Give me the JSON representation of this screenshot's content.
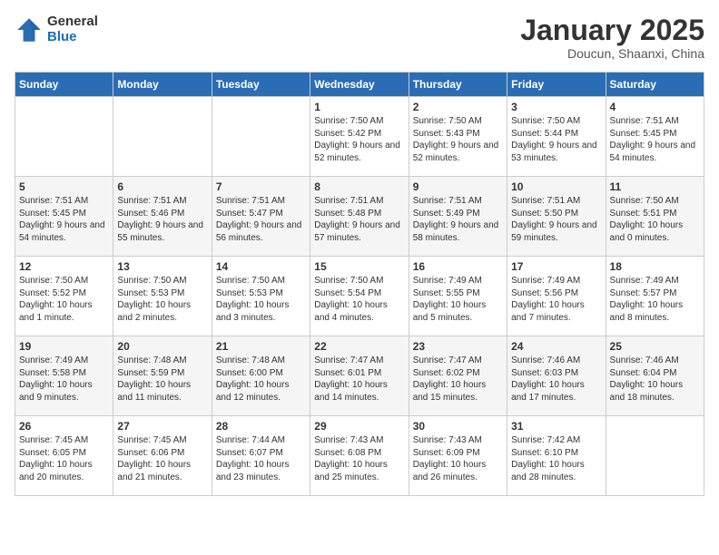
{
  "header": {
    "logo_general": "General",
    "logo_blue": "Blue",
    "month_title": "January 2025",
    "subtitle": "Doucun, Shaanxi, China"
  },
  "weekdays": [
    "Sunday",
    "Monday",
    "Tuesday",
    "Wednesday",
    "Thursday",
    "Friday",
    "Saturday"
  ],
  "weeks": [
    [
      {
        "day": "",
        "info": ""
      },
      {
        "day": "",
        "info": ""
      },
      {
        "day": "",
        "info": ""
      },
      {
        "day": "1",
        "info": "Sunrise: 7:50 AM\nSunset: 5:42 PM\nDaylight: 9 hours\nand 52 minutes."
      },
      {
        "day": "2",
        "info": "Sunrise: 7:50 AM\nSunset: 5:43 PM\nDaylight: 9 hours\nand 52 minutes."
      },
      {
        "day": "3",
        "info": "Sunrise: 7:50 AM\nSunset: 5:44 PM\nDaylight: 9 hours\nand 53 minutes."
      },
      {
        "day": "4",
        "info": "Sunrise: 7:51 AM\nSunset: 5:45 PM\nDaylight: 9 hours\nand 54 minutes."
      }
    ],
    [
      {
        "day": "5",
        "info": "Sunrise: 7:51 AM\nSunset: 5:45 PM\nDaylight: 9 hours\nand 54 minutes."
      },
      {
        "day": "6",
        "info": "Sunrise: 7:51 AM\nSunset: 5:46 PM\nDaylight: 9 hours\nand 55 minutes."
      },
      {
        "day": "7",
        "info": "Sunrise: 7:51 AM\nSunset: 5:47 PM\nDaylight: 9 hours\nand 56 minutes."
      },
      {
        "day": "8",
        "info": "Sunrise: 7:51 AM\nSunset: 5:48 PM\nDaylight: 9 hours\nand 57 minutes."
      },
      {
        "day": "9",
        "info": "Sunrise: 7:51 AM\nSunset: 5:49 PM\nDaylight: 9 hours\nand 58 minutes."
      },
      {
        "day": "10",
        "info": "Sunrise: 7:51 AM\nSunset: 5:50 PM\nDaylight: 9 hours\nand 59 minutes."
      },
      {
        "day": "11",
        "info": "Sunrise: 7:50 AM\nSunset: 5:51 PM\nDaylight: 10 hours\nand 0 minutes."
      }
    ],
    [
      {
        "day": "12",
        "info": "Sunrise: 7:50 AM\nSunset: 5:52 PM\nDaylight: 10 hours\nand 1 minute."
      },
      {
        "day": "13",
        "info": "Sunrise: 7:50 AM\nSunset: 5:53 PM\nDaylight: 10 hours\nand 2 minutes."
      },
      {
        "day": "14",
        "info": "Sunrise: 7:50 AM\nSunset: 5:53 PM\nDaylight: 10 hours\nand 3 minutes."
      },
      {
        "day": "15",
        "info": "Sunrise: 7:50 AM\nSunset: 5:54 PM\nDaylight: 10 hours\nand 4 minutes."
      },
      {
        "day": "16",
        "info": "Sunrise: 7:49 AM\nSunset: 5:55 PM\nDaylight: 10 hours\nand 5 minutes."
      },
      {
        "day": "17",
        "info": "Sunrise: 7:49 AM\nSunset: 5:56 PM\nDaylight: 10 hours\nand 7 minutes."
      },
      {
        "day": "18",
        "info": "Sunrise: 7:49 AM\nSunset: 5:57 PM\nDaylight: 10 hours\nand 8 minutes."
      }
    ],
    [
      {
        "day": "19",
        "info": "Sunrise: 7:49 AM\nSunset: 5:58 PM\nDaylight: 10 hours\nand 9 minutes."
      },
      {
        "day": "20",
        "info": "Sunrise: 7:48 AM\nSunset: 5:59 PM\nDaylight: 10 hours\nand 11 minutes."
      },
      {
        "day": "21",
        "info": "Sunrise: 7:48 AM\nSunset: 6:00 PM\nDaylight: 10 hours\nand 12 minutes."
      },
      {
        "day": "22",
        "info": "Sunrise: 7:47 AM\nSunset: 6:01 PM\nDaylight: 10 hours\nand 14 minutes."
      },
      {
        "day": "23",
        "info": "Sunrise: 7:47 AM\nSunset: 6:02 PM\nDaylight: 10 hours\nand 15 minutes."
      },
      {
        "day": "24",
        "info": "Sunrise: 7:46 AM\nSunset: 6:03 PM\nDaylight: 10 hours\nand 17 minutes."
      },
      {
        "day": "25",
        "info": "Sunrise: 7:46 AM\nSunset: 6:04 PM\nDaylight: 10 hours\nand 18 minutes."
      }
    ],
    [
      {
        "day": "26",
        "info": "Sunrise: 7:45 AM\nSunset: 6:05 PM\nDaylight: 10 hours\nand 20 minutes."
      },
      {
        "day": "27",
        "info": "Sunrise: 7:45 AM\nSunset: 6:06 PM\nDaylight: 10 hours\nand 21 minutes."
      },
      {
        "day": "28",
        "info": "Sunrise: 7:44 AM\nSunset: 6:07 PM\nDaylight: 10 hours\nand 23 minutes."
      },
      {
        "day": "29",
        "info": "Sunrise: 7:43 AM\nSunset: 6:08 PM\nDaylight: 10 hours\nand 25 minutes."
      },
      {
        "day": "30",
        "info": "Sunrise: 7:43 AM\nSunset: 6:09 PM\nDaylight: 10 hours\nand 26 minutes."
      },
      {
        "day": "31",
        "info": "Sunrise: 7:42 AM\nSunset: 6:10 PM\nDaylight: 10 hours\nand 28 minutes."
      },
      {
        "day": "",
        "info": ""
      }
    ]
  ]
}
